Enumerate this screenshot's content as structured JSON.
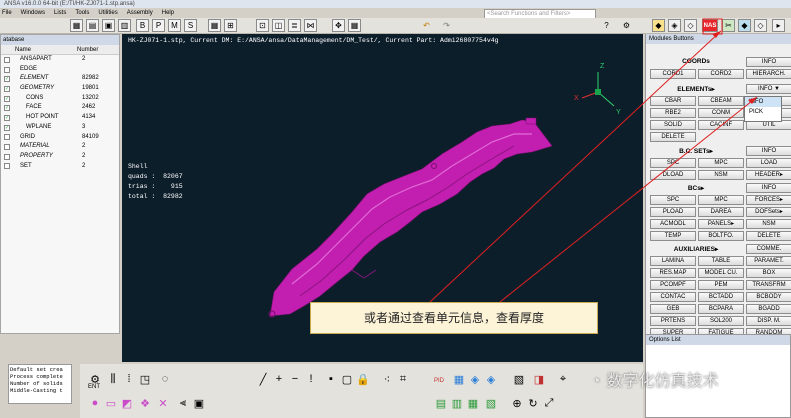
{
  "window": {
    "title": "ANSA v16.0.0 64-bit (E:/TI/HK-ZJ071-1.stp.ansa)"
  },
  "menu": [
    "File",
    "Windows",
    "Lists",
    "Tools",
    "Utilities",
    "Assembly",
    "Help"
  ],
  "search": {
    "placeholder": "<Search Functions and Filters>"
  },
  "left_panel": {
    "title": "atabase",
    "columns": [
      "Name",
      "Number"
    ],
    "rows": [
      {
        "name": "ANSAPART",
        "number": "2",
        "checked": false,
        "italic": false
      },
      {
        "name": "EDGE",
        "number": "",
        "checked": false,
        "italic": false
      },
      {
        "name": "ELEMENT",
        "number": "82982",
        "checked": true,
        "italic": true
      },
      {
        "name": "GEOMETRY",
        "number": "19801",
        "checked": true,
        "italic": true
      },
      {
        "name": "CONS",
        "number": "13202",
        "checked": true,
        "italic": false
      },
      {
        "name": "FACE",
        "number": "2462",
        "checked": true,
        "italic": false
      },
      {
        "name": "HOT POINT",
        "number": "4134",
        "checked": true,
        "italic": false
      },
      {
        "name": "WPLANE",
        "number": "3",
        "checked": true,
        "italic": false
      },
      {
        "name": "GRID",
        "number": "84109",
        "checked": false,
        "italic": false
      },
      {
        "name": "MATERIAL",
        "number": "2",
        "checked": false,
        "italic": true
      },
      {
        "name": "PROPERTY",
        "number": "2",
        "checked": false,
        "italic": true
      },
      {
        "name": "SET",
        "number": "2",
        "checked": false,
        "italic": false
      }
    ]
  },
  "viewport": {
    "header": "HK-ZJ071-1.stp,  Current DM: E:/ANSA/ansa/DataManagement/DM_Test/,  Current Part: Admi26807754v4g",
    "stats": {
      "label": "Shell",
      "quads_label": "quads :",
      "quads": "82067",
      "trias_label": "trias :",
      "trias": "915",
      "total_label": "total :",
      "total": "82982"
    },
    "axes": {
      "x": "X",
      "y": "Y",
      "z": "Z"
    }
  },
  "right_panel": {
    "title": "Modules Buttons",
    "coords": {
      "title": "COORDs",
      "buttons": [
        "INFO",
        "CORD1",
        "CORD2",
        "HIERARCH."
      ]
    },
    "elements": {
      "title": "ELEMENTs▸",
      "info": "INFO ▼",
      "buttons": [
        "CBAR",
        "CBEAM",
        "CBUSH",
        "RBE2",
        "CONM",
        "SHELL",
        "SOLID",
        "CACINF",
        "UTIL",
        "DELETE"
      ]
    },
    "dropdown": [
      "INFO",
      "PICK"
    ],
    "bcsets": {
      "title": "B.C. SETs▸",
      "buttons": [
        "INFO",
        "SPC",
        "MPC",
        "LOAD",
        "DLOAD",
        "NSM",
        "HEADER▸"
      ]
    },
    "bcs": {
      "title": "BCs▸",
      "buttons": [
        "INFO",
        "SPC",
        "MPC",
        "FORCES▸",
        "PLOAD",
        "DAREA",
        "DOFSets▸",
        "ACMODL",
        "PANELS▸",
        "NSM",
        "TEMP",
        "BOLTFO.",
        "DELETE"
      ]
    },
    "aux": {
      "title": "AUXILIARIES▸",
      "buttons": [
        "COMME.",
        "LAMINA",
        "TABLE",
        "PARAMET.",
        "RES.MAP",
        "MODEL CU.",
        "BOX",
        "PCOMPF",
        "PEM",
        "TRANSFRM",
        "CONTAC",
        "BCTADD",
        "BCBODY",
        "GEB",
        "BCPARA",
        "BGADD",
        "PRTENS",
        "SOL200",
        "DISP. M.",
        "SUPER",
        "FATIGUE",
        "RANDOM"
      ]
    }
  },
  "options_list": {
    "title": "Options List"
  },
  "console": {
    "lines": [
      "Default set crea",
      "Process complete",
      "Number of solids",
      "Middle-Casting t"
    ]
  },
  "bottom_toolbar": {
    "ent_label": "ENT",
    "pid_label": "PID"
  },
  "callout": {
    "text": "或者通过查看单元信息，查看厚度"
  },
  "watermark": {
    "text": "数字化仿真技术"
  },
  "colors": {
    "viewport_bg": "#0d1e2b",
    "part": "#c21fb0",
    "nastran_badge": "#e8232a",
    "arrow": "#e02020"
  }
}
